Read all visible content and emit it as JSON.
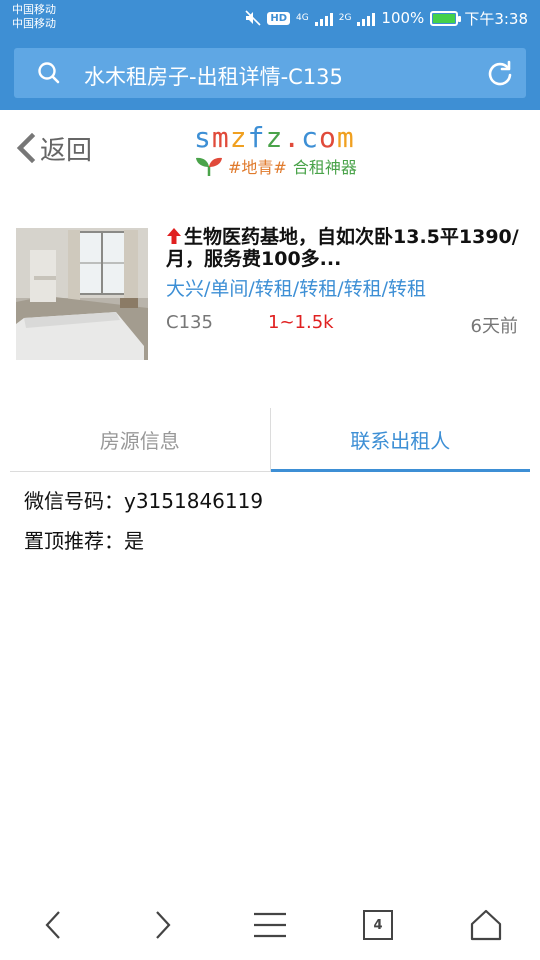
{
  "status_bar": {
    "carrier_1": "中国移动",
    "carrier_2": "中国移动",
    "hd": "HD",
    "net_1": "4G",
    "net_2": "2G",
    "battery_percent": "100%",
    "battery_level": 1.0,
    "time": "下午3:38"
  },
  "browser": {
    "url_text": "水木租房子-出租详情-C135",
    "search_icon": "search-icon",
    "reload_icon": "reload-icon"
  },
  "header": {
    "back_label": "返回",
    "logo": {
      "letters": [
        "s",
        "m",
        "z",
        "f",
        "z",
        ".",
        "c",
        "o",
        "m"
      ],
      "letter_colors": [
        "#3d8fd5",
        "#e04a3a",
        "#f0a020",
        "#3d8fd5",
        "#4aa34a",
        "#e04a3a",
        "#3d8fd5",
        "#e04a3a",
        "#f0a020"
      ],
      "tag": "#地青#",
      "tagline": "合租神器"
    }
  },
  "listing": {
    "title": "生物医药基地，自如次卧13.5平1390/月，服务费100多...",
    "tags": "大兴/单间/转租/转租/转租/转租",
    "id": "C135",
    "price": "1~1.5k",
    "time": "6天前"
  },
  "tabs": {
    "info": "房源信息",
    "contact": "联系出租人",
    "active": "contact"
  },
  "contact": {
    "wechat": "微信号码：y3151846119",
    "pinned": "置顶推荐：是"
  },
  "bottom_nav": {
    "tab_count": "4"
  },
  "colors": {
    "accent": "#3d8fd5",
    "toolbar": "#3e8fd4",
    "price": "#e02020"
  }
}
